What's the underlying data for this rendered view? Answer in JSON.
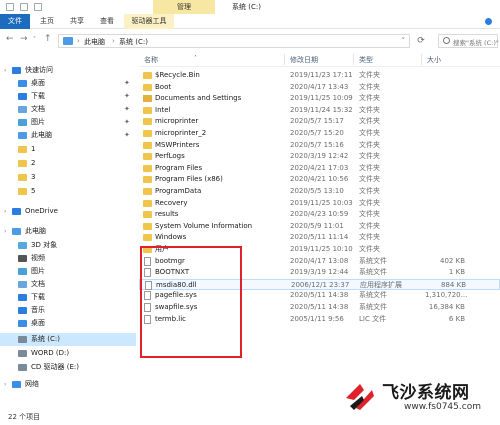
{
  "window": {
    "title": "系统 (C:)",
    "manage_tab": "管理"
  },
  "ribbon": {
    "tabs": [
      "文件",
      "主页",
      "共享",
      "查看",
      "驱动器工具"
    ]
  },
  "address": {
    "crumbs": [
      "此电脑",
      "系统 (C:)"
    ],
    "search_placeholder": "搜索\"系统 (C:)\""
  },
  "nav": {
    "items": [
      {
        "label": "快速访问",
        "icon": "star-icon",
        "color": "#2b7de0"
      },
      {
        "label": "桌面",
        "icon": "desktop-icon",
        "color": "#3a8ee6",
        "pinned": true
      },
      {
        "label": "下载",
        "icon": "download-icon",
        "color": "#2b7de0",
        "pinned": true
      },
      {
        "label": "文档",
        "icon": "document-icon",
        "color": "#6aa5dc",
        "pinned": true
      },
      {
        "label": "图片",
        "icon": "picture-icon",
        "color": "#4aa0d8",
        "pinned": true
      },
      {
        "label": "此电脑",
        "icon": "computer-icon",
        "color": "#4d9be6",
        "pinned": true
      },
      {
        "label": "1",
        "icon": "folder-icon",
        "color": "#f0c54b"
      },
      {
        "label": "2",
        "icon": "folder-icon",
        "color": "#f0c54b"
      },
      {
        "label": "3",
        "icon": "folder-icon",
        "color": "#f0c54b"
      },
      {
        "label": "5",
        "icon": "folder-icon",
        "color": "#f0c54b"
      },
      {
        "label": "OneDrive",
        "icon": "cloud-icon",
        "color": "#2b7de0"
      },
      {
        "label": "此电脑",
        "icon": "computer-icon",
        "color": "#4d9be6"
      },
      {
        "label": "3D 对象",
        "icon": "cube-icon",
        "color": "#55a8e0"
      },
      {
        "label": "视频",
        "icon": "video-icon",
        "color": "#555"
      },
      {
        "label": "图片",
        "icon": "picture-icon",
        "color": "#4aa0d8"
      },
      {
        "label": "文档",
        "icon": "document-icon",
        "color": "#6aa5dc"
      },
      {
        "label": "下载",
        "icon": "download-icon",
        "color": "#2b7de0"
      },
      {
        "label": "音乐",
        "icon": "music-icon",
        "color": "#2b7de0"
      },
      {
        "label": "桌面",
        "icon": "desktop-icon",
        "color": "#3a8ee6"
      },
      {
        "label": "系统 (C:)",
        "icon": "drive-icon",
        "color": "#7a8a99",
        "selected": true
      },
      {
        "label": "WORD (D:)",
        "icon": "drive-icon",
        "color": "#7a8a99"
      },
      {
        "label": "CD 驱动器 (E:)",
        "icon": "cd-drive-icon",
        "color": "#7a8a99"
      },
      {
        "label": "网络",
        "icon": "network-icon",
        "color": "#3a8ee6"
      }
    ]
  },
  "columns": [
    "名称",
    "修改日期",
    "类型",
    "大小"
  ],
  "files": [
    {
      "name": "$Recycle.Bin",
      "date": "2019/11/23 17:11",
      "type": "文件夹",
      "size": "",
      "kind": "folder"
    },
    {
      "name": "Boot",
      "date": "2020/4/17 13:43",
      "type": "文件夹",
      "size": "",
      "kind": "folder"
    },
    {
      "name": "Documents and Settings",
      "date": "2019/11/25 10:09",
      "type": "文件夹",
      "size": "",
      "kind": "sysfolder"
    },
    {
      "name": "Intel",
      "date": "2019/11/24 15:32",
      "type": "文件夹",
      "size": "",
      "kind": "folder"
    },
    {
      "name": "microprinter",
      "date": "2020/5/7 15:17",
      "type": "文件夹",
      "size": "",
      "kind": "folder"
    },
    {
      "name": "microprinter_2",
      "date": "2020/5/7 15:20",
      "type": "文件夹",
      "size": "",
      "kind": "folder"
    },
    {
      "name": "MSWPrinters",
      "date": "2020/5/7 15:16",
      "type": "文件夹",
      "size": "",
      "kind": "folder"
    },
    {
      "name": "PerfLogs",
      "date": "2020/3/19 12:42",
      "type": "文件夹",
      "size": "",
      "kind": "folder"
    },
    {
      "name": "Program Files",
      "date": "2020/4/21 17:03",
      "type": "文件夹",
      "size": "",
      "kind": "folder"
    },
    {
      "name": "Program Files (x86)",
      "date": "2020/4/21 10:56",
      "type": "文件夹",
      "size": "",
      "kind": "folder"
    },
    {
      "name": "ProgramData",
      "date": "2020/5/5 13:10",
      "type": "文件夹",
      "size": "",
      "kind": "folder"
    },
    {
      "name": "Recovery",
      "date": "2019/11/25 10:03",
      "type": "文件夹",
      "size": "",
      "kind": "folder"
    },
    {
      "name": "results",
      "date": "2020/4/23 10:59",
      "type": "文件夹",
      "size": "",
      "kind": "folder"
    },
    {
      "name": "System Volume Information",
      "date": "2020/5/9 11:01",
      "type": "文件夹",
      "size": "",
      "kind": "folder"
    },
    {
      "name": "Windows",
      "date": "2020/5/11 11:14",
      "type": "文件夹",
      "size": "",
      "kind": "folder"
    },
    {
      "name": "用户",
      "date": "2019/11/25 10:10",
      "type": "文件夹",
      "size": "",
      "kind": "folder"
    },
    {
      "name": "bootmgr",
      "date": "2020/4/17 13:08",
      "type": "系统文件",
      "size": "402 KB",
      "kind": "file"
    },
    {
      "name": "BOOTNXT",
      "date": "2019/3/19 12:44",
      "type": "系统文件",
      "size": "1 KB",
      "kind": "file"
    },
    {
      "name": "msdia80.dll",
      "date": "2006/12/1 23:37",
      "type": "应用程序扩展",
      "size": "884 KB",
      "kind": "file",
      "highlight": true
    },
    {
      "name": "pagefile.sys",
      "date": "2020/5/11 14:38",
      "type": "系统文件",
      "size": "1,310,720...",
      "kind": "file"
    },
    {
      "name": "swapfile.sys",
      "date": "2020/5/11 14:38",
      "type": "系统文件",
      "size": "16,384 KB",
      "kind": "file"
    },
    {
      "name": "termb.lic",
      "date": "2005/1/11 9:56",
      "type": "LIC 文件",
      "size": "6 KB",
      "kind": "file"
    }
  ],
  "status": {
    "item_count": "22 个项目"
  },
  "watermark": {
    "title": "飞沙系统网",
    "url": "www.fs0745.com"
  }
}
